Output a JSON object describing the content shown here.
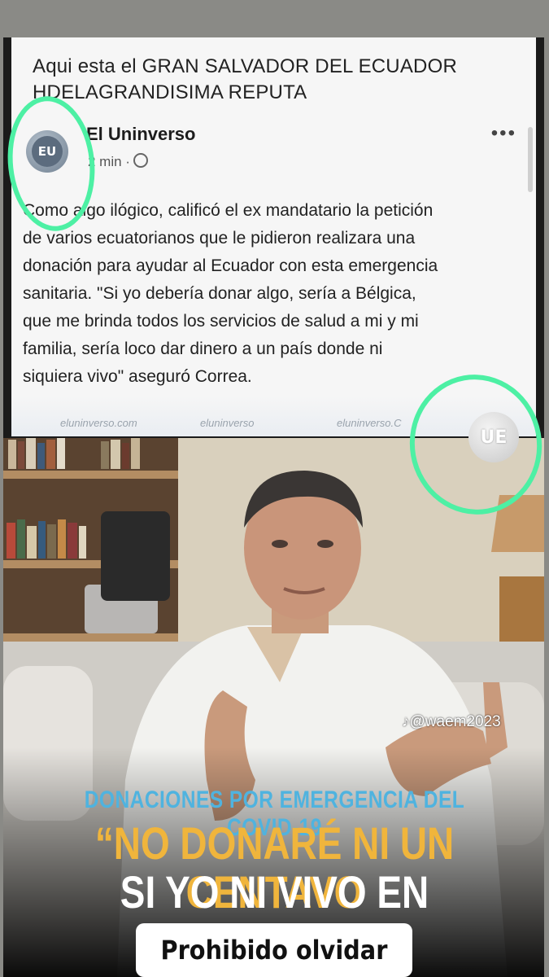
{
  "post": {
    "header_line1": "Aqui esta el GRAN SALVADOR DEL ECUADOR",
    "header_line2": "HDELAGRANDISIMA REPUTA",
    "page_name": "El Uninverso",
    "avatar_text": "EU",
    "timestamp": "2 min",
    "more": "•••",
    "body": [
      "Como algo ilógico, calificó el ex mandatario la petición",
      "de varios ecuatorianos que le pidieron realizara una",
      "donación para ayudar al Ecuador con esta emergencia",
      "sanitaria. \"Si yo debería donar algo, sería a Bélgica,",
      "que me brinda todos los servicios de salud a mi y mi",
      "familia, sería loco dar dinero a un país donde ni",
      "siquiera vivo\" aseguró Correa."
    ],
    "watermarks": [
      "eluninverso.com",
      "eluninverso",
      "eluninverso.C"
    ],
    "logo_text": "UE"
  },
  "video": {
    "tiktok_handle": "@waem2023",
    "subtitle1": "DONACIONES POR EMERGENCIA DEL COVID-19",
    "subtitle2": "“NO DONARÉ NI UN CENTAVO",
    "subtitle3": "SI YO NI VIVO EN ECUADOR”"
  },
  "caption": "Prohibido olvidar",
  "colors": {
    "annotation_ring": "#4df0a4",
    "subtitle_blue": "#4fb3df",
    "subtitle_gold": "#f0b53c"
  }
}
